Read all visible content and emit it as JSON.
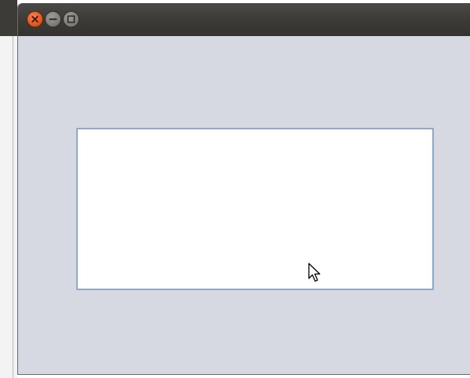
{
  "window": {
    "controls": [
      {
        "name": "close",
        "icon": "close-icon",
        "color": "#e1541b"
      },
      {
        "name": "minimize",
        "icon": "minimize-icon",
        "color": "#7a7872"
      },
      {
        "name": "maximize",
        "icon": "maximize-icon",
        "color": "#7a7872"
      }
    ],
    "background_color": "#d6d9e1",
    "titlebar_color": "#3c3b37"
  },
  "content_box": {
    "background_color": "#ffffff",
    "border_color": "#8ea9cc"
  },
  "cursor": {
    "icon": "mouse-pointer-icon"
  }
}
